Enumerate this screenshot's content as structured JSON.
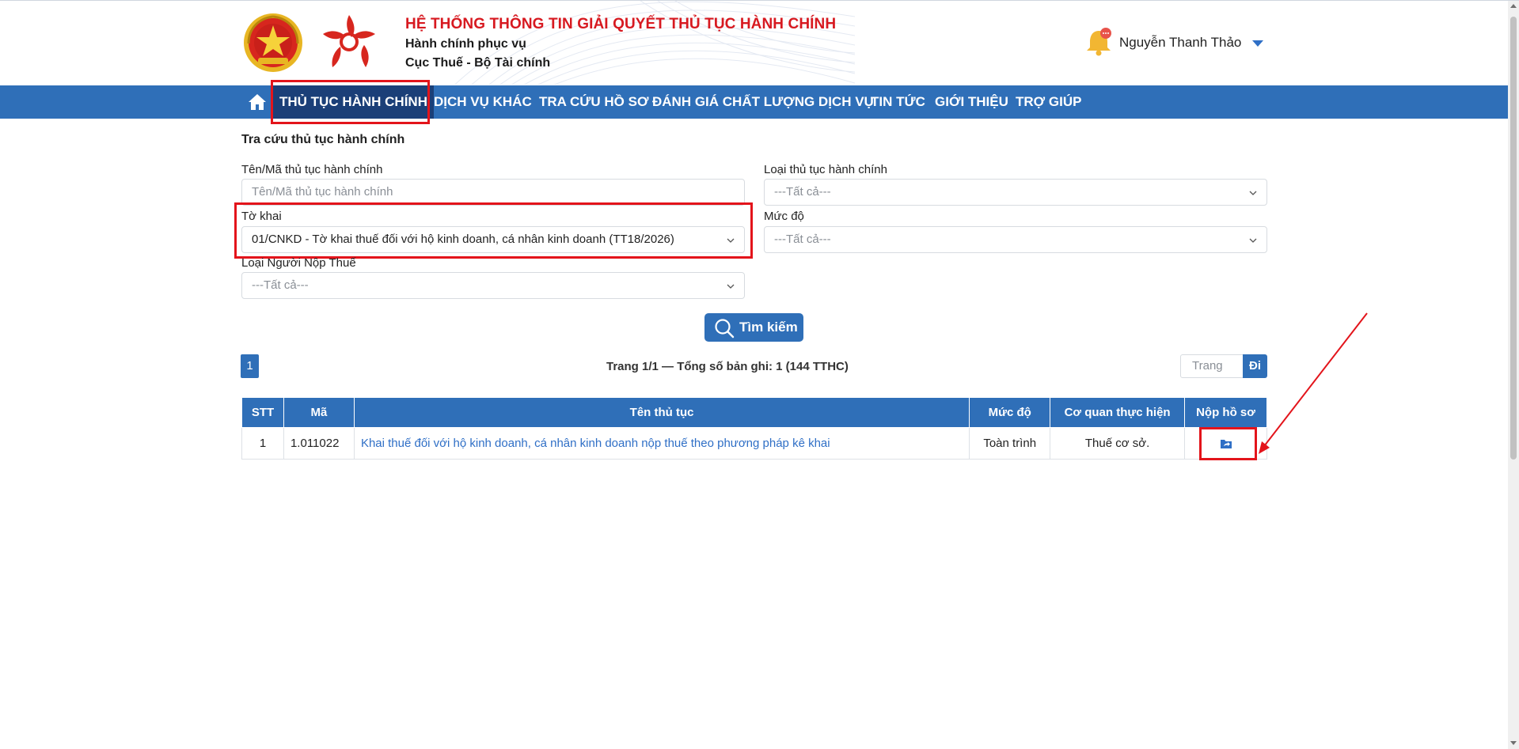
{
  "header": {
    "system_title": "HỆ THỐNG THÔNG TIN GIẢI QUYẾT THỦ TỤC HÀNH CHÍNH",
    "subtitle_1": "Hành chính phục vụ",
    "subtitle_2": "Cục Thuế - Bộ Tài chính",
    "user_name": "Nguyễn Thanh Thảo",
    "notification_icon": "bell-icon"
  },
  "nav": {
    "items": [
      {
        "label": "THỦ TỤC HÀNH CHÍNH",
        "active": true
      },
      {
        "label": "DỊCH VỤ KHÁC"
      },
      {
        "label": "TRA CỨU HỒ SƠ"
      },
      {
        "label": "ĐÁNH GIÁ CHẤT LƯỢNG DỊCH VỤ"
      },
      {
        "label": "TIN TỨC"
      },
      {
        "label": "GIỚI THIỆU"
      },
      {
        "label": "TRỢ GIÚP"
      }
    ]
  },
  "search": {
    "section_title": "Tra cứu thủ tục hành chính",
    "name_label": "Tên/Mã thủ tục hành chính",
    "name_placeholder": "Tên/Mã thủ tục hành chính",
    "type_label": "Loại thủ tục hành chính",
    "type_value": "---Tất cả---",
    "form_label": "Tờ khai",
    "form_value": "01/CNKD - Tờ khai thuế đối với hộ kinh doanh, cá nhân kinh doanh (TT18/2026)",
    "level_label": "Mức độ",
    "level_value": "---Tất cả---",
    "taxpayer_label": "Loại Người Nộp Thuế",
    "taxpayer_value": "---Tất cả---",
    "search_button": "Tìm kiếm"
  },
  "pagination": {
    "current_page": "1",
    "info": "Trang 1/1 — Tổng số bản ghi: 1 (144 TTHC)",
    "page_placeholder": "Trang",
    "go_label": "Đi"
  },
  "table": {
    "headers": [
      "STT",
      "Mã",
      "Tên thủ tục",
      "Mức độ",
      "Cơ quan thực hiện",
      "Nộp hồ sơ"
    ],
    "rows": [
      {
        "stt": "1",
        "code": "1.011022",
        "name": "Khai thuế đối với hộ kinh doanh, cá nhân kinh doanh nộp thuế theo phương pháp kê khai",
        "level": "Toàn trình",
        "agency": "Thuế cơ sở.",
        "submit_icon": "folder-upload-icon"
      }
    ]
  },
  "colors": {
    "primary": "#2f6fb8",
    "nav_active": "#1b3f78",
    "title_red": "#d71920",
    "highlight": "#e3141b",
    "link": "#2f6fc6"
  }
}
